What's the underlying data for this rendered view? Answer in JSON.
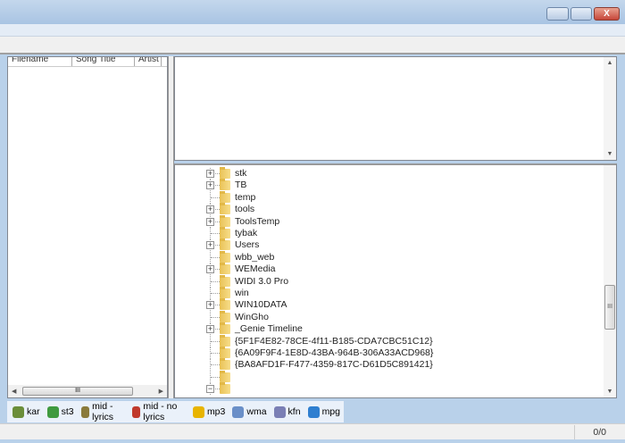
{
  "window": {
    "controls": {
      "minimize": "–",
      "maximize": "□",
      "close": "X"
    }
  },
  "file_list": {
    "columns": [
      "Filename",
      "Song Title",
      "Artist"
    ],
    "scroll_thumb": "III"
  },
  "tree": {
    "items": [
      {
        "label": "stk",
        "expandable": true
      },
      {
        "label": "TB",
        "expandable": true
      },
      {
        "label": "temp",
        "expandable": false
      },
      {
        "label": "tools",
        "expandable": true
      },
      {
        "label": "ToolsTemp",
        "expandable": true
      },
      {
        "label": "tybak",
        "expandable": false
      },
      {
        "label": "Users",
        "expandable": true
      },
      {
        "label": "wbb_web",
        "expandable": false
      },
      {
        "label": "WEMedia",
        "expandable": true
      },
      {
        "label": "WIDI 3.0 Pro",
        "expandable": false
      },
      {
        "label": "win",
        "expandable": false
      },
      {
        "label": "WIN10DATA",
        "expandable": true
      },
      {
        "label": "WinGho",
        "expandable": false
      },
      {
        "label": "_Genie Timeline",
        "expandable": true
      },
      {
        "label": "{5F1F4E82-78CE-4f11-B185-CDA7CBC51C12}",
        "expandable": false
      },
      {
        "label": "{6A09F9F4-1E8D-43BA-964B-306A33ACD968}",
        "expandable": false
      },
      {
        "label": "{BA8AFD1F-F477-4359-817C-D61D5C891421}",
        "expandable": false
      },
      {
        "label": "",
        "expandable": false
      },
      {
        "label": "",
        "expandable": "collapse"
      }
    ],
    "scroll_thumb": "III"
  },
  "legend": [
    {
      "label": "kar",
      "icon": "karaoke-icon",
      "color": "#6b8e3a"
    },
    {
      "label": "st3",
      "icon": "karaoke-icon",
      "color": "#3f9a3f"
    },
    {
      "label": "mid - lyrics",
      "icon": "karaoke-icon",
      "color": "#8a7a3a"
    },
    {
      "label": "mid - no lyrics",
      "icon": "music-note-icon",
      "color": "#c0392b"
    },
    {
      "label": "mp3",
      "icon": "mp3-icon",
      "color": "#e8b400"
    },
    {
      "label": "wma",
      "icon": "wma-icon",
      "color": "#6a8fc8"
    },
    {
      "label": "kfn",
      "icon": "kfn-icon",
      "color": "#7a7fb5"
    },
    {
      "label": "mpg",
      "icon": "play-icon",
      "color": "#2f7fd0"
    }
  ],
  "status": {
    "count": "0/0"
  }
}
